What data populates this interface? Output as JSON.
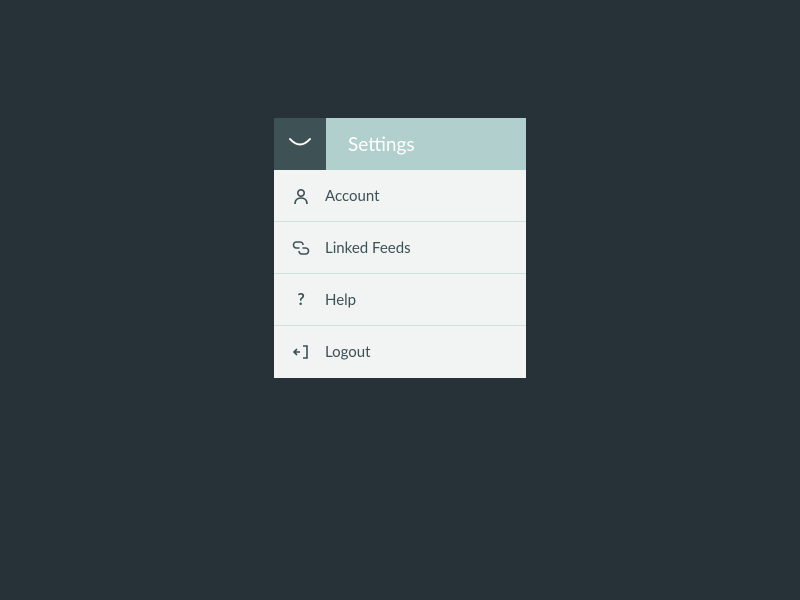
{
  "header": {
    "title": "Settings"
  },
  "menu": {
    "items": [
      {
        "label": "Account",
        "icon": "account-icon"
      },
      {
        "label": "Linked Feeds",
        "icon": "link-icon"
      },
      {
        "label": "Help",
        "icon": "help-icon"
      },
      {
        "label": "Logout",
        "icon": "logout-icon"
      }
    ]
  },
  "colors": {
    "background": "#263238",
    "headerBg": "#b1cfcc",
    "logoBg": "#3e5155",
    "panelBg": "#f1f4f3",
    "border": "#cee2e0",
    "text": "#3e5155"
  }
}
